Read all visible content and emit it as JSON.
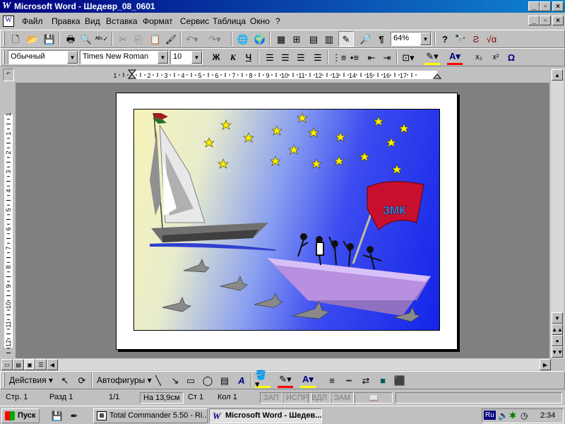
{
  "window": {
    "title": "Microsoft Word - Шедевр_08_0601",
    "buttons": [
      "_",
      "▫",
      "×"
    ]
  },
  "menu": {
    "items": [
      "Файл",
      "Правка",
      "Вид",
      "Вставка",
      "Формат",
      "Сервис",
      "Таблица",
      "Окно",
      "?"
    ]
  },
  "standard_toolbar": {
    "zoom": "64%"
  },
  "formatting_toolbar": {
    "style": "Обычный",
    "font": "Times New Roman",
    "size": "10",
    "bold": "Ж",
    "italic": "К",
    "underline": "Ч"
  },
  "ruler": {
    "h_ticks": [
      "1",
      "1",
      "2",
      "3",
      "4",
      "5",
      "6",
      "7",
      "8",
      "9",
      "10",
      "11",
      "12",
      "13",
      "14",
      "15",
      "16",
      "17"
    ],
    "v_ticks": [
      "1",
      "1",
      "2",
      "3",
      "4",
      "5",
      "6",
      "7",
      "8",
      "9",
      "10",
      "11",
      "12"
    ]
  },
  "picture": {
    "flag_text": "ЗМК",
    "colors": {
      "sky_light": "#f7f4b8",
      "sea_dark": "#1424e8",
      "flag_red": "#c8102e",
      "boat_violet": "#b890e0",
      "star": "#ffee00"
    }
  },
  "drawing_toolbar": {
    "actions": "Действия",
    "autoshapes": "Автофигуры"
  },
  "status": {
    "page": "Стр. 1",
    "section": "Разд 1",
    "pages": "1/1",
    "at": "На 13,9см",
    "line": "Ст 1",
    "col": "Кол 1",
    "rec": "ЗАП",
    "trk": "ИСПР",
    "ext": "ВДЛ",
    "ovr": "ЗАМ"
  },
  "taskbar": {
    "start": "Пуск",
    "tasks": [
      "Total Commander 5.50 - Ri...",
      "Microsoft Word - Шедев..."
    ],
    "lang": "Ru",
    "time": "2:34"
  }
}
